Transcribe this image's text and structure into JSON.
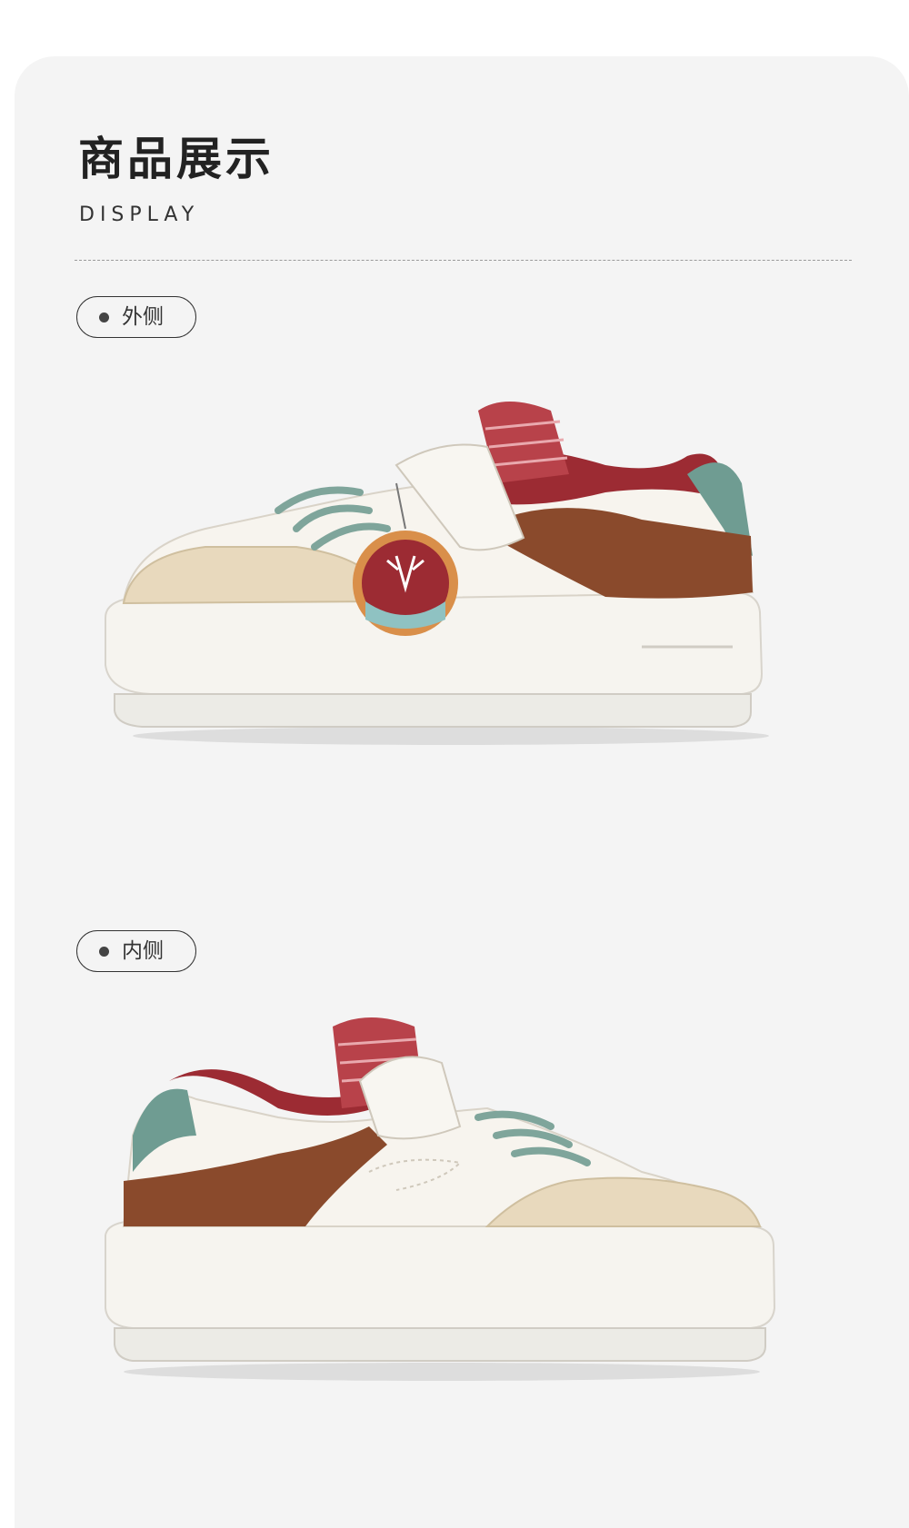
{
  "header": {
    "title_cn": "商品展示",
    "title_en": "DISPLAY"
  },
  "sections": [
    {
      "label": "外侧",
      "image": "sneaker-outer-side"
    },
    {
      "label": "内侧",
      "image": "sneaker-inner-side"
    }
  ],
  "colors": {
    "page_bg": "#ffffff",
    "panel_bg": "#f4f4f4",
    "text": "#222222",
    "shoe_cream": "#f3efe6",
    "shoe_tan": "#e8d9bd",
    "shoe_brown": "#8a4a2c",
    "shoe_burgundy": "#9c2b33",
    "shoe_teal": "#6f9c92"
  }
}
